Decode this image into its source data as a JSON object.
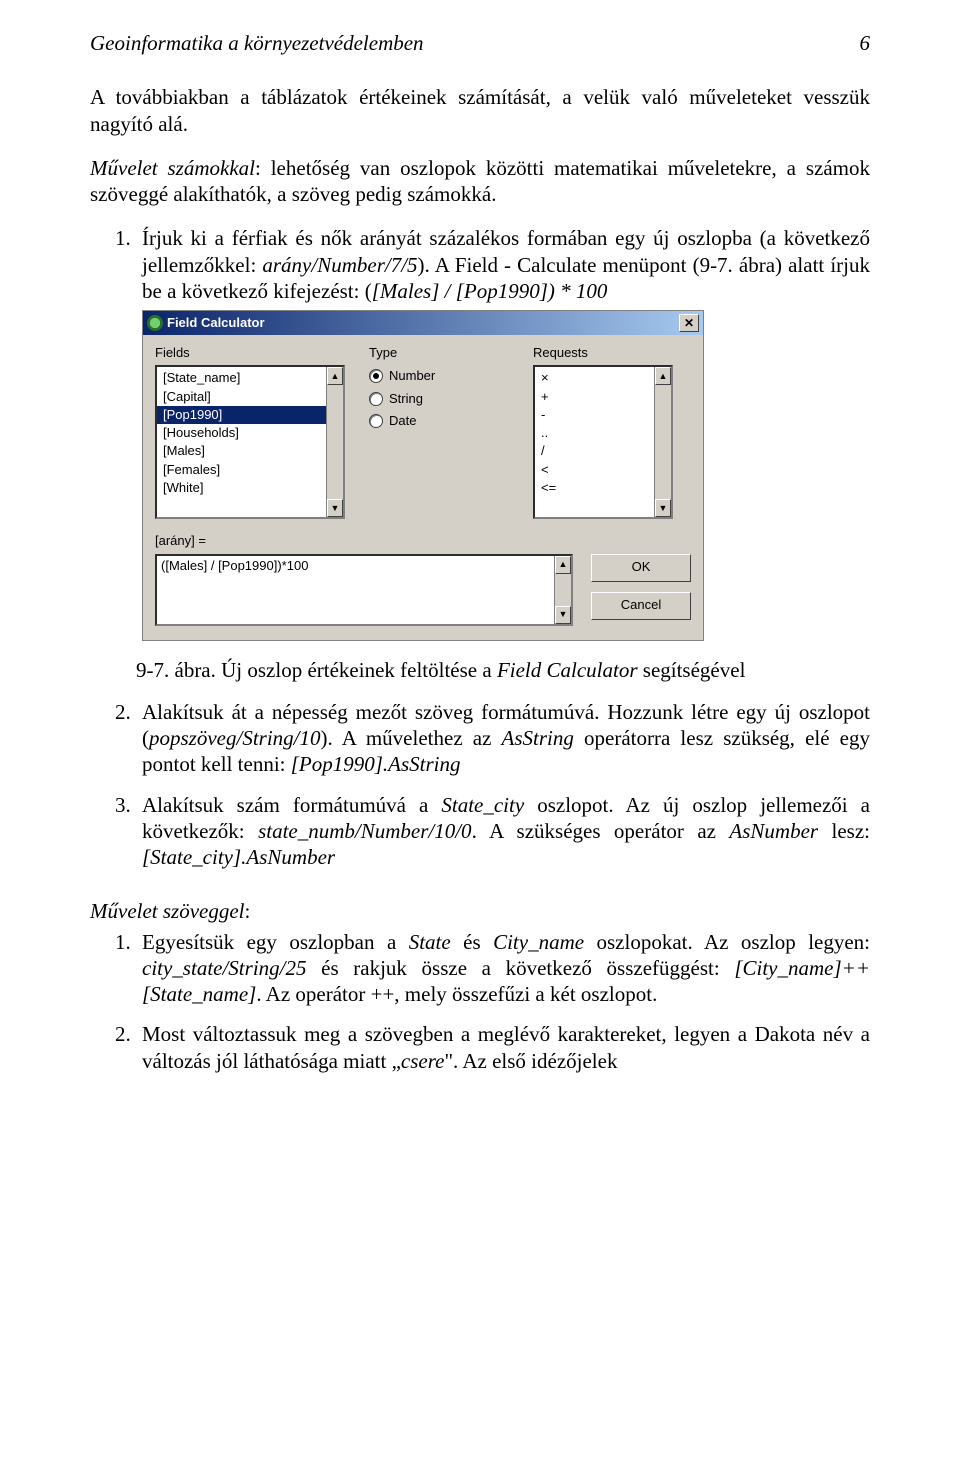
{
  "header": {
    "title": "Geoinformatika a környezetvédelemben",
    "page_num": "6"
  },
  "para_intro": "A továbbiakban a táblázatok értékeinek számítását, a velük való műveleteket vesszük nagyító alá.",
  "para_muv_num_prefix": "Művelet számokkal",
  "para_muv_num_rest": ": lehetőség van oszlopok közötti matematikai műveletekre, a számok szöveggé alakíthatók, a szöveg pedig számokká.",
  "list1": {
    "item1_a": "Írjuk ki a férfiak és nők arányát százalékos formában egy új oszlopba (a következő jellemzőkkel: ",
    "item1_b": "arány/Number/7/5",
    "item1_c": "). A Field - Calculate menüpont (9-7. ábra) alatt írjuk be a következő kifejezést: (",
    "item1_d": "[Males] / [Pop1990]) * 100"
  },
  "dialog": {
    "title": "Field Calculator",
    "labels": {
      "fields": "Fields",
      "type": "Type",
      "requests": "Requests"
    },
    "fields_items": [
      "[State_name]",
      "[Capital]",
      "[Pop1990]",
      "[Households]",
      "[Males]",
      "[Females]",
      "[White]"
    ],
    "fields_selected_index": 2,
    "type_options": [
      "Number",
      "String",
      "Date"
    ],
    "type_selected_index": 0,
    "requests_items": [
      "×",
      "+",
      "-",
      "..",
      "/",
      "<",
      "<="
    ],
    "expr_label": "[arány] =",
    "expr_value": "([Males] / [Pop1990])*100",
    "ok": "OK",
    "cancel": "Cancel"
  },
  "caption_a": "9-7. ábra. Új oszlop értékeinek feltöltése a ",
  "caption_b": "Field Calculator",
  "caption_c": " segítségével",
  "list2": {
    "item2_a": "Alakítsuk át a népesség mezőt szöveg formátumúvá. Hozzunk létre egy új oszlopot (",
    "item2_b": "popszöveg/String/10",
    "item2_c": "). A művelethez az ",
    "item2_d": "AsString",
    "item2_e": " operátorra lesz szükség, elé egy pontot kell tenni: ",
    "item2_f": "[Pop1990].AsString",
    "item3_a": "Alakítsuk szám formátumúvá a ",
    "item3_b": "State_city",
    "item3_c": " oszlopot. Az új oszlop jellemezői a következők: ",
    "item3_d": "state_numb/Number/10/0",
    "item3_e": ". A szükséges operátor az ",
    "item3_f": "AsNumber",
    "item3_g": " lesz: ",
    "item3_h": "[State_city].AsNumber"
  },
  "sect2_prefix": "Művelet szöveggel",
  "sect2_suffix": ":",
  "list3": {
    "item1_a": "Egyesítsük egy oszlopban a ",
    "item1_b": "State",
    "item1_c": " és ",
    "item1_d": "City_name",
    "item1_e": " oszlopokat. Az oszlop legyen: ",
    "item1_f": "city_state/String/25",
    "item1_g": " és rakjuk össze a következő összefüggést: ",
    "item1_h": "[City_name]++[State_name]",
    "item1_i": ". Az operátor ++, mely összefűzi a két oszlopot.",
    "item2_a": "Most változtassuk meg a szövegben a meglévő karaktereket, legyen a Dakota név a változás jól láthatósága miatt „",
    "item2_b": "csere",
    "item2_c": "\". Az első idézőjelek"
  }
}
